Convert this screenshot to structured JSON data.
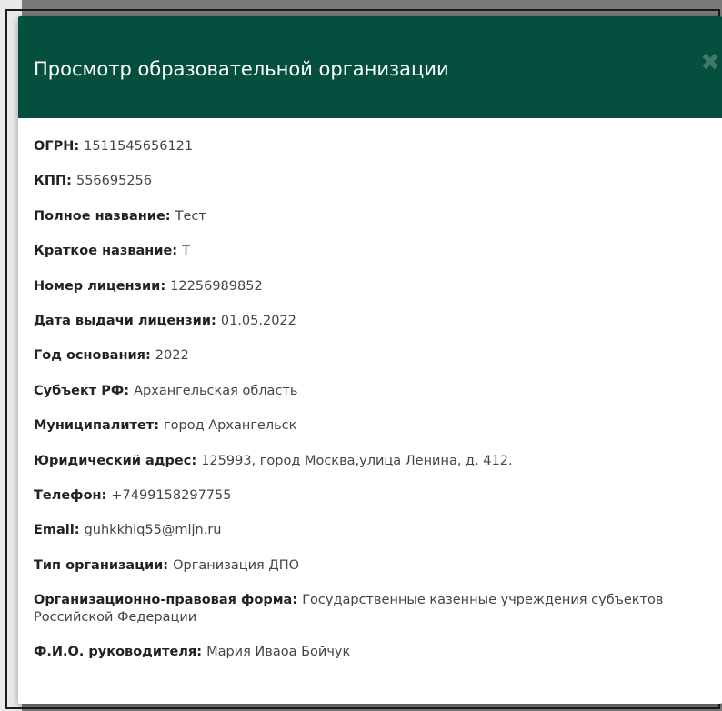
{
  "modal": {
    "title": "Просмотр образовательной организации",
    "close_icon": "close-x-icon",
    "header_color": "#044f3d"
  },
  "fields": [
    {
      "label": "ОГРН:",
      "value": "1511545656121"
    },
    {
      "label": "КПП:",
      "value": "556695256"
    },
    {
      "label": "Полное название:",
      "value": "Тест"
    },
    {
      "label": "Краткое название:",
      "value": "Т"
    },
    {
      "label": "Номер лицензии:",
      "value": "12256989852"
    },
    {
      "label": "Дата выдачи лицензии:",
      "value": "01.05.2022"
    },
    {
      "label": "Год основания:",
      "value": "2022"
    },
    {
      "label": "Субъект РФ:",
      "value": "Архангельская область"
    },
    {
      "label": "Муниципалитет:",
      "value": "город Архангельск"
    },
    {
      "label": "Юридический адрес:",
      "value": "125993, город Москва,улица Ленина, д. 412."
    },
    {
      "label": "Телефон:",
      "value": "+7499158297755"
    },
    {
      "label": "Email:",
      "value": "guhkkhiq55@mljn.ru"
    },
    {
      "label": "Тип организации:",
      "value": "Организация ДПО"
    },
    {
      "label": "Организационно-правовая форма:",
      "value": "Государственные казенные учреждения субъектов Российской Федерации"
    },
    {
      "label": "Ф.И.О. руководителя:",
      "value": "Мария Иваоа Бойчук"
    }
  ]
}
